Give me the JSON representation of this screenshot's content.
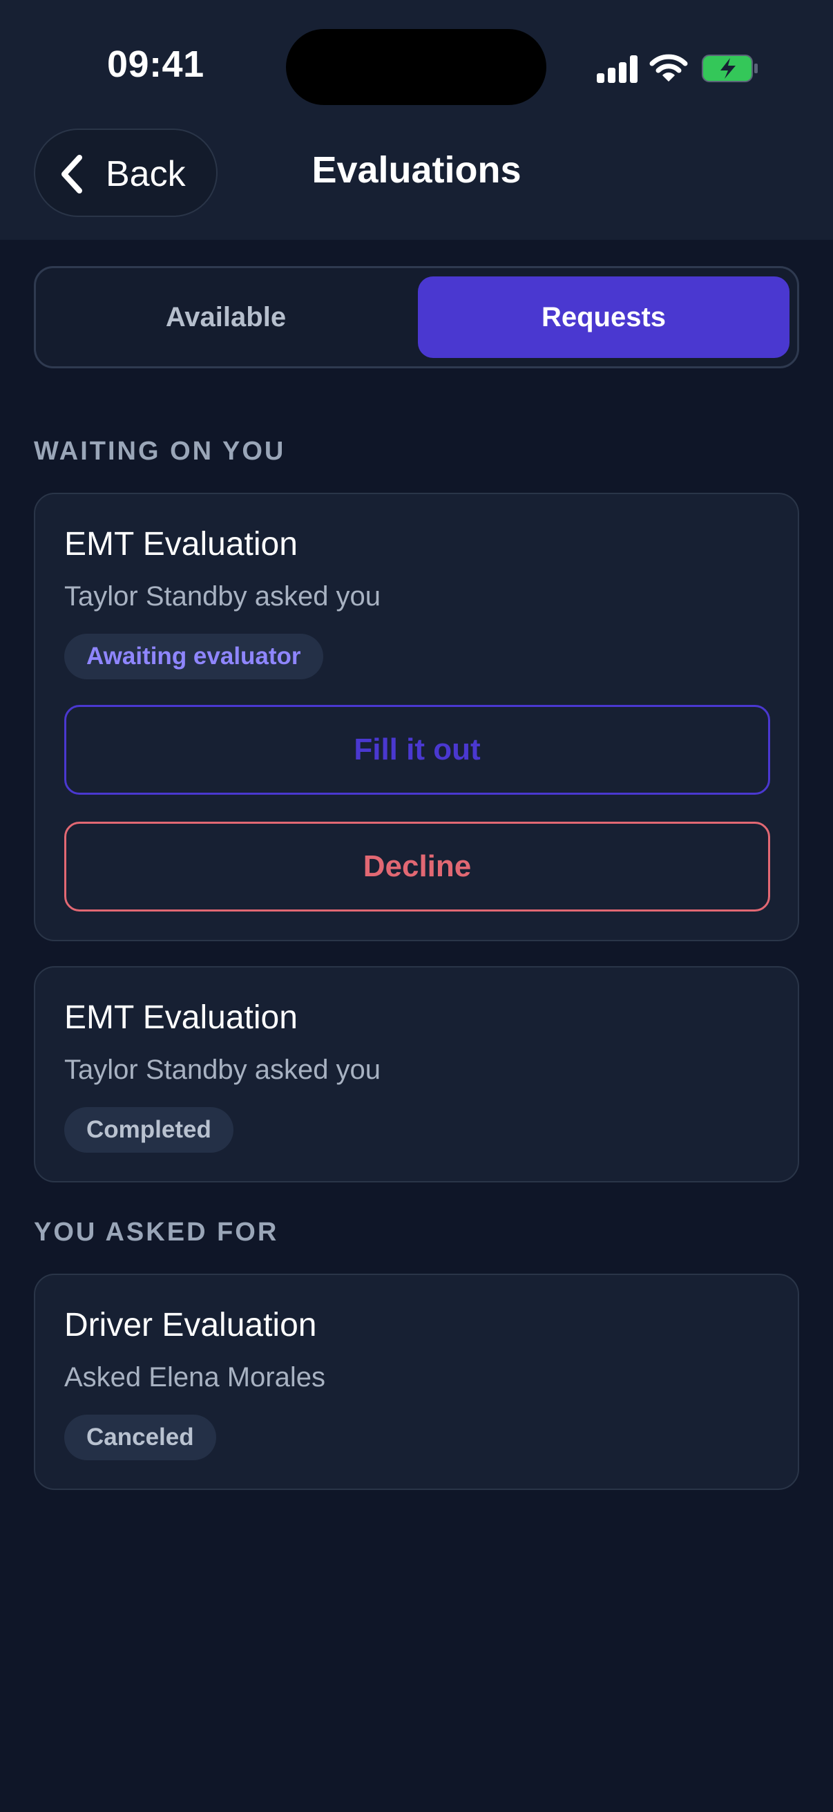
{
  "status_bar": {
    "time": "09:41"
  },
  "header": {
    "back_label": "Back",
    "title": "Evaluations"
  },
  "segmented_control": {
    "tabs": [
      {
        "label": "Available",
        "selected": false
      },
      {
        "label": "Requests",
        "selected": true
      }
    ]
  },
  "sections": {
    "waiting": {
      "label": "WAITING ON YOU",
      "cards": [
        {
          "title": "EMT Evaluation",
          "subtitle": "Taylor Standby asked you",
          "badge": "Awaiting evaluator",
          "primary_action": "Fill it out",
          "secondary_action": "Decline"
        },
        {
          "title": "EMT Evaluation",
          "subtitle": "Taylor Standby asked you",
          "badge": "Completed"
        }
      ]
    },
    "asked": {
      "label": "YOU ASKED FOR",
      "cards": [
        {
          "title": "Driver Evaluation",
          "subtitle": "Asked Elena Morales",
          "badge": "Canceled"
        }
      ]
    }
  },
  "colors": {
    "accent": "#4a38d0",
    "danger": "#e26873",
    "background": "#0f1628",
    "card": "#172033"
  }
}
